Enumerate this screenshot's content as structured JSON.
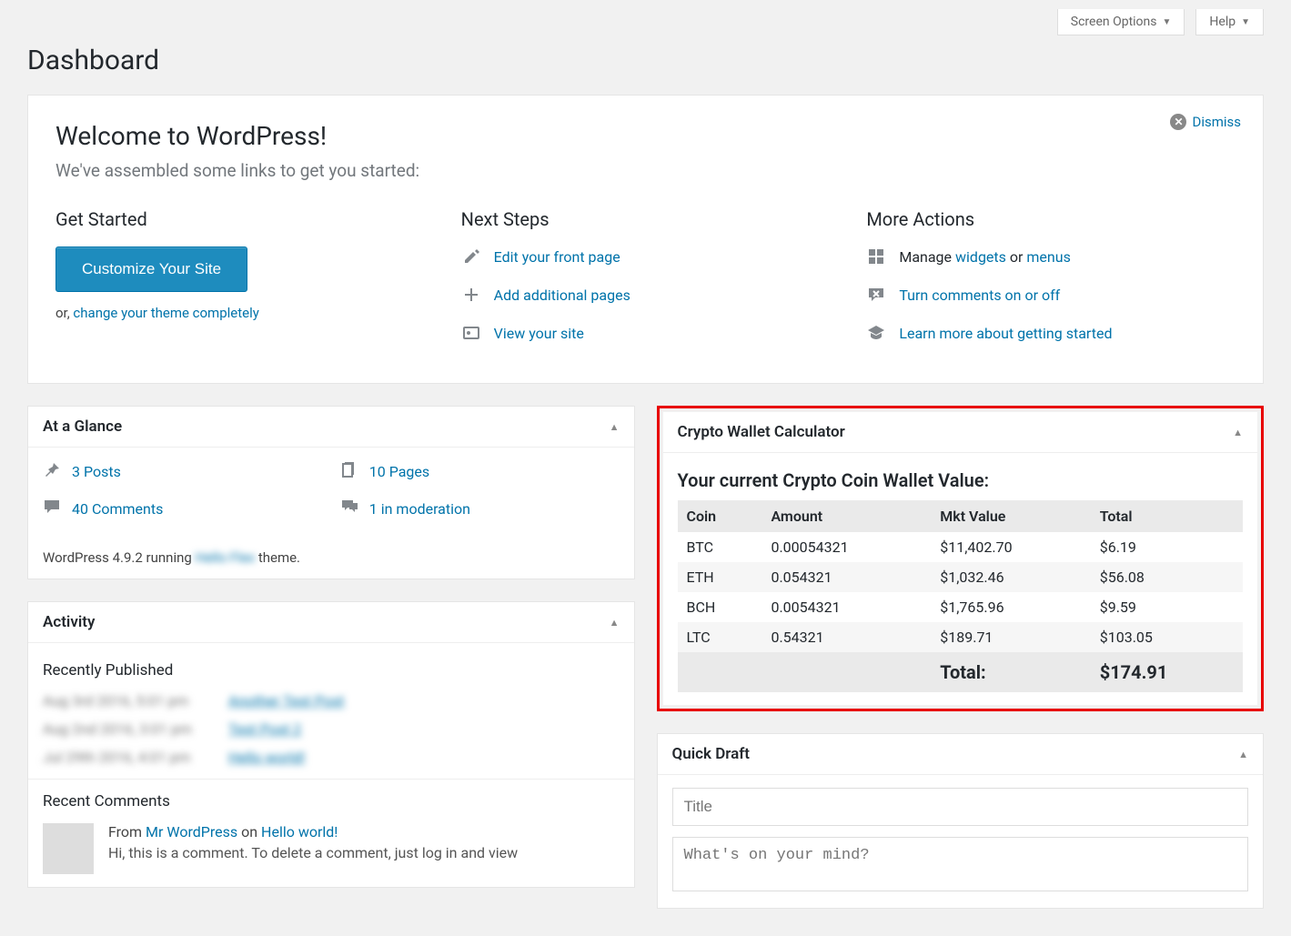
{
  "top": {
    "screen_options": "Screen Options",
    "help": "Help"
  },
  "page_title": "Dashboard",
  "welcome": {
    "title": "Welcome to WordPress!",
    "subtitle": "We've assembled some links to get you started:",
    "dismiss": "Dismiss",
    "get_started": {
      "heading": "Get Started",
      "customize_btn": "Customize Your Site",
      "or_text": "or, ",
      "change_theme": "change your theme completely"
    },
    "next_steps": {
      "heading": "Next Steps",
      "edit_front": "Edit your front page",
      "add_pages": "Add additional pages",
      "view_site": "View your site"
    },
    "more_actions": {
      "heading": "More Actions",
      "manage_prefix": "Manage ",
      "widgets": "widgets",
      "or": " or ",
      "menus": "menus",
      "comments_toggle": "Turn comments on or off",
      "learn_more": "Learn more about getting started"
    }
  },
  "glance": {
    "title": "At a Glance",
    "posts": "3 Posts",
    "pages": "10 Pages",
    "comments": "40 Comments",
    "moderation": "1 in moderation",
    "version_prefix": "WordPress 4.9.2 running ",
    "theme_blur": "Hello Flex",
    "version_suffix": " theme."
  },
  "activity": {
    "title": "Activity",
    "recently_published": "Recently Published",
    "items": [
      {
        "date": "Aug 3rd 2016, 5:01 pm",
        "link": "Another Test Post"
      },
      {
        "date": "Aug 2nd 2016, 3:01 pm",
        "link": "Test Post 2"
      },
      {
        "date": "Jul 29th 2016, 4:01 pm",
        "link": "Hello world!"
      }
    ],
    "recent_comments": "Recent Comments",
    "comment": {
      "from": "From ",
      "author": "Mr WordPress",
      "on": " on ",
      "post": "Hello world!",
      "body": "Hi, this is a comment. To delete a comment, just log in and view"
    }
  },
  "crypto": {
    "box_title": "Crypto Wallet Calculator",
    "heading": "Your current Crypto Coin Wallet Value:",
    "cols": {
      "coin": "Coin",
      "amount": "Amount",
      "mkt": "Mkt Value",
      "total": "Total"
    },
    "rows": [
      {
        "coin": "BTC",
        "amount": "0.00054321",
        "mkt": "$11,402.70",
        "total": "$6.19"
      },
      {
        "coin": "ETH",
        "amount": "0.054321",
        "mkt": "$1,032.46",
        "total": "$56.08"
      },
      {
        "coin": "BCH",
        "amount": "0.0054321",
        "mkt": "$1,765.96",
        "total": "$9.59"
      },
      {
        "coin": "LTC",
        "amount": "0.54321",
        "mkt": "$189.71",
        "total": "$103.05"
      }
    ],
    "total_label": "Total:",
    "total_value": "$174.91"
  },
  "quick_draft": {
    "title": "Quick Draft",
    "title_placeholder": "Title",
    "content_placeholder": "What's on your mind?"
  },
  "chart_data": {
    "type": "table",
    "title": "Your current Crypto Coin Wallet Value:",
    "columns": [
      "Coin",
      "Amount",
      "Mkt Value",
      "Total"
    ],
    "rows": [
      [
        "BTC",
        0.00054321,
        11402.7,
        6.19
      ],
      [
        "ETH",
        0.054321,
        1032.46,
        56.08
      ],
      [
        "BCH",
        0.0054321,
        1765.96,
        9.59
      ],
      [
        "LTC",
        0.54321,
        189.71,
        103.05
      ]
    ],
    "grand_total": 174.91
  }
}
